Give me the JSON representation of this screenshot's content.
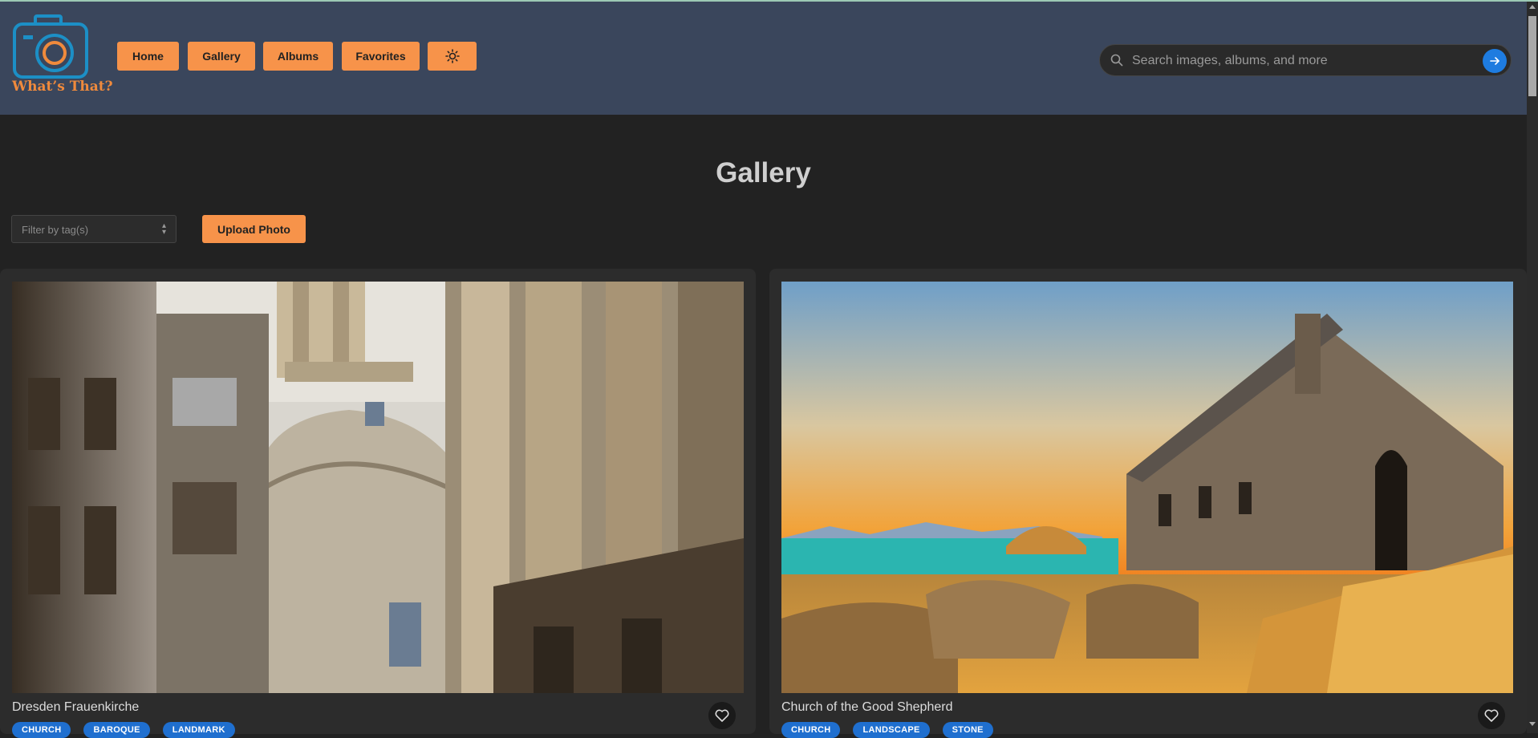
{
  "app": {
    "logo_text": "What’s That?"
  },
  "nav": {
    "items": [
      {
        "label": "Home"
      },
      {
        "label": "Gallery"
      },
      {
        "label": "Albums"
      },
      {
        "label": "Favorites"
      }
    ],
    "theme_toggle_icon": "sun-icon"
  },
  "search": {
    "placeholder": "Search images, albums, and more",
    "value": ""
  },
  "page": {
    "title": "Gallery"
  },
  "filter": {
    "placeholder": "Filter by tag(s)"
  },
  "upload": {
    "label": "Upload Photo"
  },
  "cards": [
    {
      "title": "Dresden Frauenkirche",
      "tags": [
        "CHURCH",
        "BAROQUE",
        "LANDMARK"
      ]
    },
    {
      "title": "Church of the Good Shepherd",
      "tags": [
        "CHURCH",
        "LANDSCAPE",
        "STONE"
      ]
    }
  ],
  "colors": {
    "header_bg": "#3a465c",
    "accent_orange": "#f7934a",
    "tag_blue": "#1f6fcf",
    "page_bg": "#222222"
  }
}
